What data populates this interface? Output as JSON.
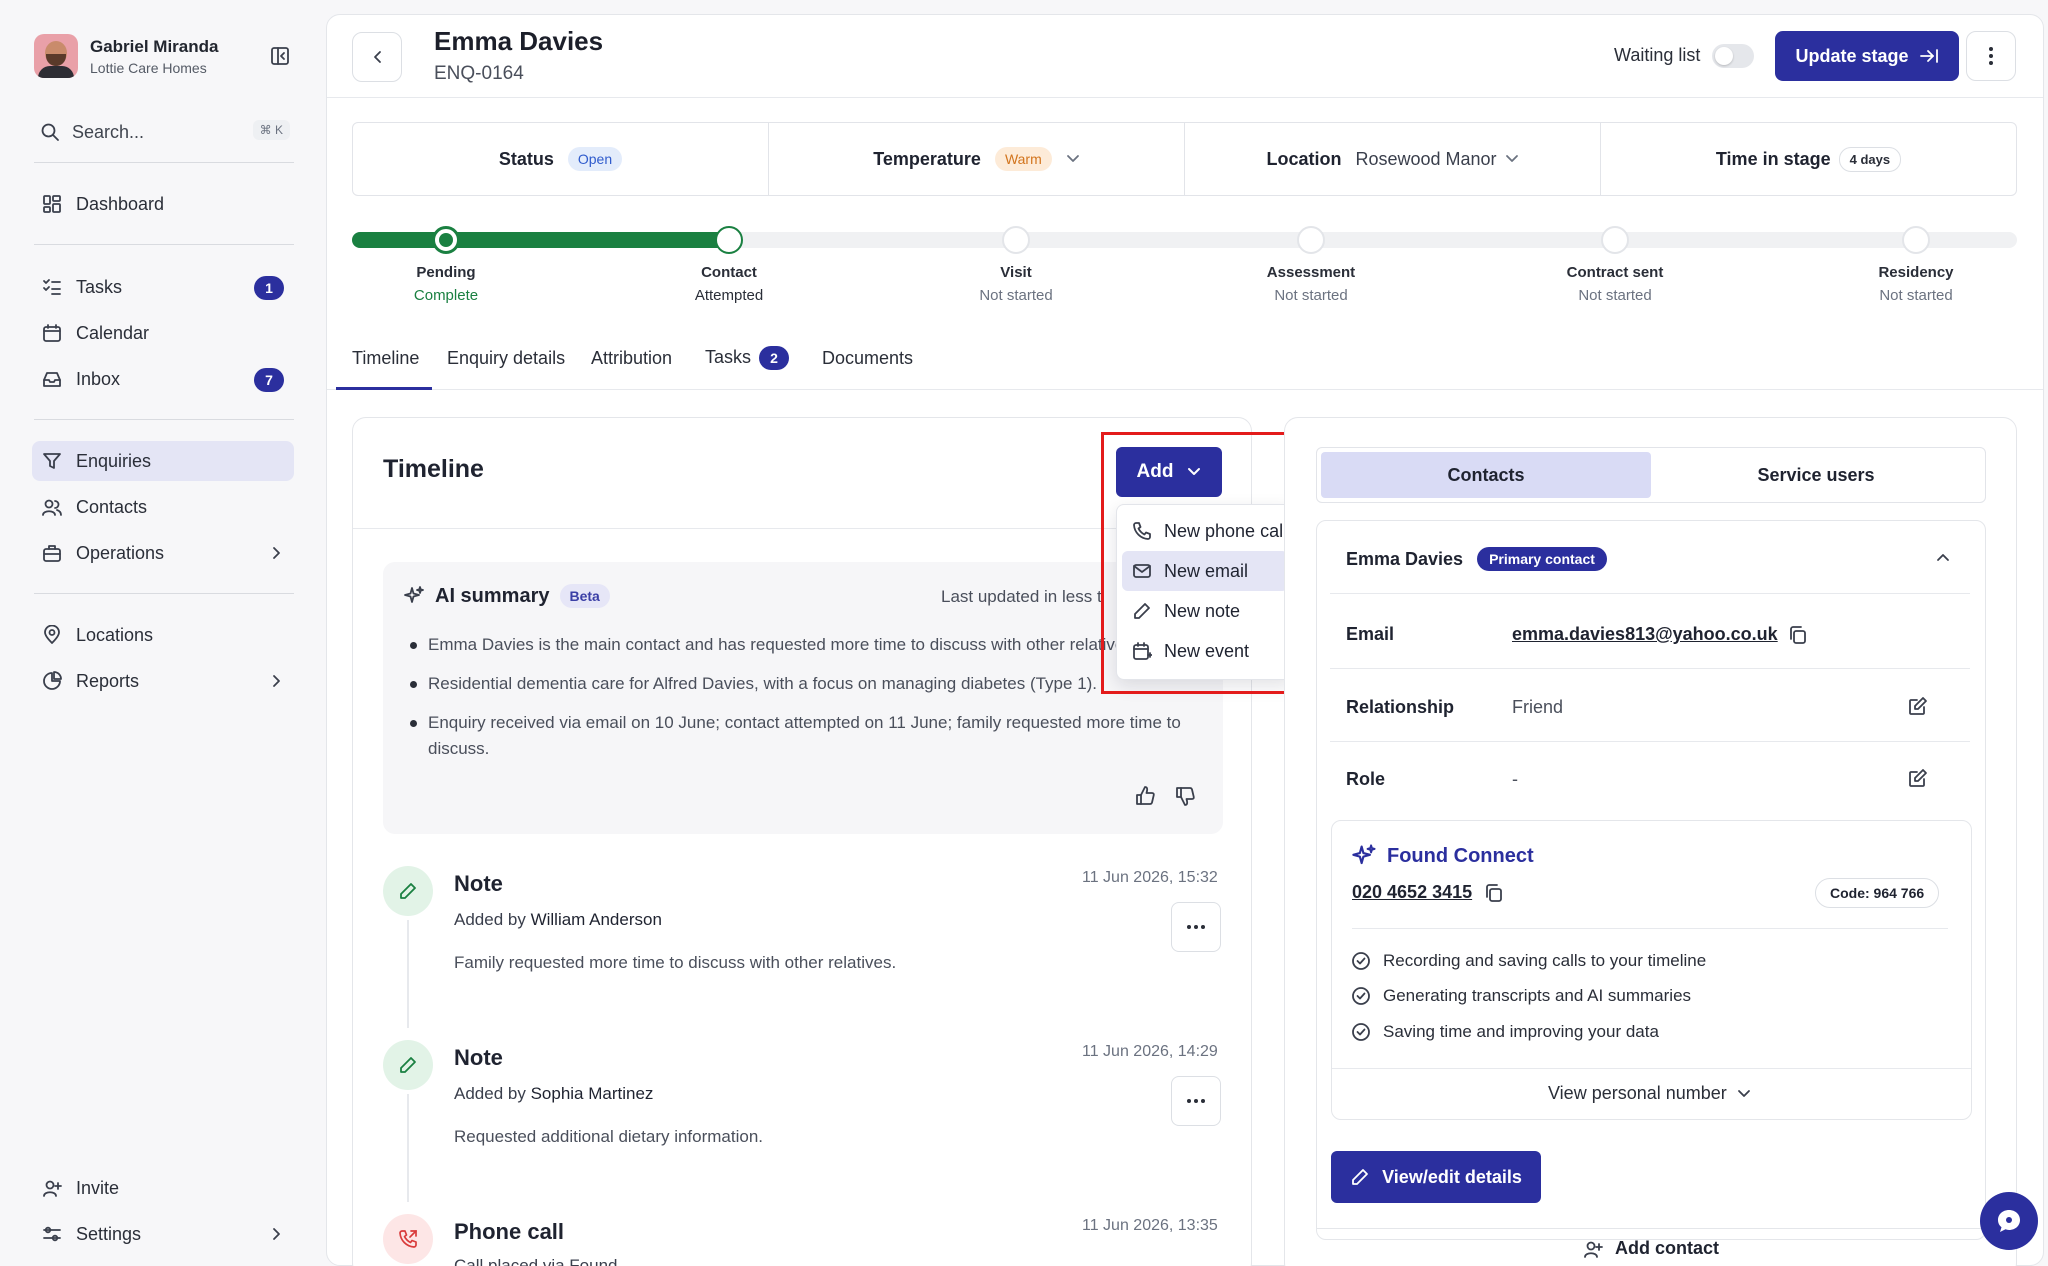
{
  "user": {
    "name": "Gabriel Miranda",
    "org": "Lottie Care Homes"
  },
  "search": {
    "placeholder": "Search...",
    "shortcut": "⌘ K"
  },
  "nav": {
    "dashboard": "Dashboard",
    "tasks": "Tasks",
    "tasks_count": "1",
    "calendar": "Calendar",
    "inbox": "Inbox",
    "inbox_count": "7",
    "enquiries": "Enquiries",
    "contacts": "Contacts",
    "operations": "Operations",
    "locations": "Locations",
    "reports": "Reports",
    "invite": "Invite",
    "settings": "Settings"
  },
  "header": {
    "title": "Emma Davies",
    "ref": "ENQ-0164",
    "waiting_list": "Waiting list",
    "update_stage": "Update stage"
  },
  "status": {
    "status_label": "Status",
    "status_value": "Open",
    "temp_label": "Temperature",
    "temp_value": "Warm",
    "location_label": "Location",
    "location_value": "Rosewood Manor",
    "time_label": "Time in stage",
    "time_value": "4 days"
  },
  "stages": [
    {
      "name": "Pending",
      "state": "Complete"
    },
    {
      "name": "Contact",
      "state": "Attempted"
    },
    {
      "name": "Visit",
      "state": "Not started"
    },
    {
      "name": "Assessment",
      "state": "Not started"
    },
    {
      "name": "Contract sent",
      "state": "Not started"
    },
    {
      "name": "Residency",
      "state": "Not started"
    }
  ],
  "tabs": {
    "timeline": "Timeline",
    "enquiry": "Enquiry details",
    "attribution": "Attribution",
    "tasks": "Tasks",
    "tasks_count": "2",
    "documents": "Documents"
  },
  "timeline": {
    "title": "Timeline",
    "add": "Add",
    "menu": {
      "call": "New phone call",
      "email": "New email",
      "note": "New note",
      "event": "New event"
    },
    "ai": {
      "title": "AI summary",
      "beta": "Beta",
      "updated": "Last updated in less than",
      "bullets": [
        "Emma Davies is the main contact and has requested more time to discuss with other relatives.",
        "Residential dementia care for Alfred Davies, with a focus on managing diabetes (Type 1).",
        "Enquiry received via email on 10 June; contact attempted on 11 June; family requested more time to discuss."
      ]
    },
    "entries": [
      {
        "title": "Note",
        "by_prefix": "Added by",
        "by": "William Anderson",
        "date": "11 Jun 2026, 15:32",
        "body": "Family requested more time to discuss with other relatives."
      },
      {
        "title": "Note",
        "by_prefix": "Added by",
        "by": "Sophia Martinez",
        "date": "11 Jun 2026, 14:29",
        "body": "Requested additional dietary information."
      },
      {
        "title": "Phone call",
        "date": "11 Jun 2026, 13:35",
        "body": "Call placed via Found"
      }
    ]
  },
  "contacts": {
    "tab_contacts": "Contacts",
    "tab_service": "Service users",
    "name": "Emma Davies",
    "primary": "Primary contact",
    "email_label": "Email",
    "email": "emma.davies813@yahoo.co.uk",
    "rel_label": "Relationship",
    "rel": "Friend",
    "role_label": "Role",
    "role": "-",
    "found": {
      "title": "Found Connect",
      "phone": "020 4652 3415",
      "code": "Code: 964 766",
      "features": [
        "Recording and saving calls to your timeline",
        "Generating transcripts and AI summaries",
        "Saving time and improving your data"
      ],
      "view_number": "View personal number"
    },
    "view_edit": "View/edit details",
    "add_contact": "Add contact"
  }
}
